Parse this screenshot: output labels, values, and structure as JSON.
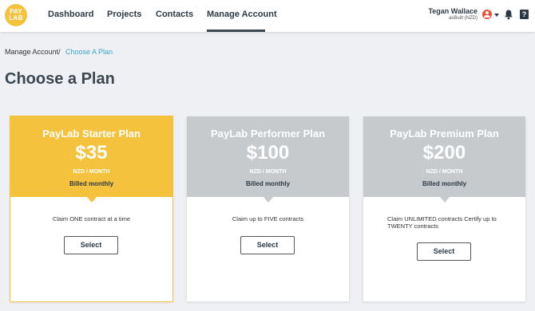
{
  "colors": {
    "brand_yellow": "#f5c23e",
    "plan_grey": "#c6cacd",
    "link_blue": "#3aa6c9",
    "avatar_red": "#e8503a"
  },
  "header": {
    "logo_text": "PAYLAB",
    "nav": [
      {
        "label": "Dashboard"
      },
      {
        "label": "Projects"
      },
      {
        "label": "Contacts"
      },
      {
        "label": "Manage Account",
        "active": true
      }
    ],
    "user": {
      "name": "Tegan Wallace",
      "org": "asBuilt (NZD)"
    },
    "icons": [
      "user-avatar-icon",
      "chevron-down-icon",
      "bell-icon",
      "help-icon"
    ],
    "help_glyph": "?"
  },
  "breadcrumb": {
    "root": "Manage Account",
    "separator": "/",
    "current": "Choose A Plan"
  },
  "page_title": "Choose a Plan",
  "plans": [
    {
      "name": "PayLab Starter Plan",
      "price": "$35",
      "unit": "NZD / MONTH",
      "billing": "Billed monthly",
      "description": "Claim ONE contract at a time",
      "button": "Select",
      "header_color": "#f5c23e",
      "selected": true
    },
    {
      "name": "PayLab Performer Plan",
      "price": "$100",
      "unit": "NZD / MONTH",
      "billing": "Billed monthly",
      "description": "Claim up to FIVE contracts",
      "button": "Select",
      "header_color": "#c6cacd",
      "selected": false
    },
    {
      "name": "PayLab Premium Plan",
      "price": "$200",
      "unit": "NZD / MONTH",
      "billing": "Billed monthly",
      "description": "Claim UNLIMITED contracts Certify up to TWENTY contracts",
      "button": "Select",
      "header_color": "#c6cacd",
      "selected": false
    }
  ]
}
